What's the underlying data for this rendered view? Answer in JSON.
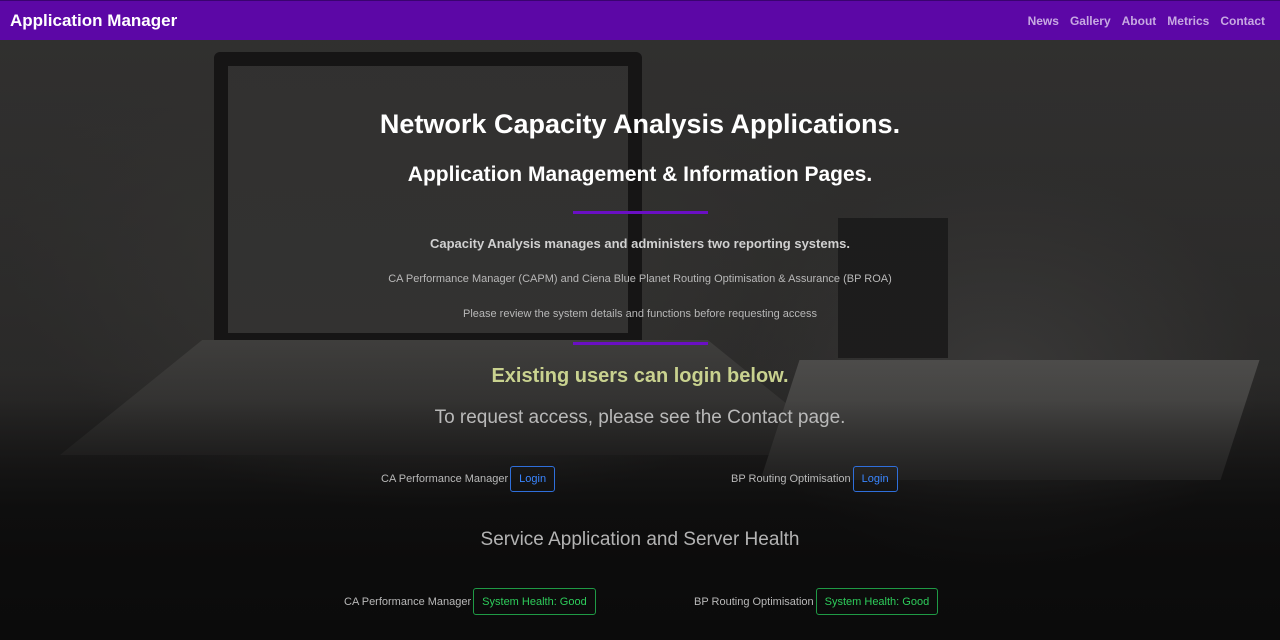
{
  "navbar": {
    "brand": "Application Manager",
    "links": [
      "News",
      "Gallery",
      "About",
      "Metrics",
      "Contact"
    ]
  },
  "hero": {
    "title": "Network Capacity Analysis Applications.",
    "subtitle": "Application Management & Information Pages.",
    "lead": "Capacity Analysis manages and administers two reporting systems.",
    "systems_line": "CA Performance Manager (CAPM) and Ciena Blue Planet Routing Optimisation & Assurance (BP ROA)",
    "review_line": "Please review the system details and functions before requesting access",
    "existing_users": "Existing users can login below.",
    "request_access": "To request access, please see the Contact page."
  },
  "logins": [
    {
      "label": "CA Performance Manager",
      "button": "Login"
    },
    {
      "label": "BP Routing Optimisation",
      "button": "Login"
    }
  ],
  "health": {
    "title": "Service Application and Server Health",
    "items": [
      {
        "label": "CA Performance Manager",
        "status": "System Health: Good"
      },
      {
        "label": "BP Routing Optimisation",
        "status": "System Health: Good"
      }
    ]
  },
  "colors": {
    "navbar": "#5c07a6",
    "divider": "#6a0fc4",
    "login_button": "#3a86ff",
    "health_good": "#2ecc5b",
    "existing_users_text": "#c9d28f"
  }
}
